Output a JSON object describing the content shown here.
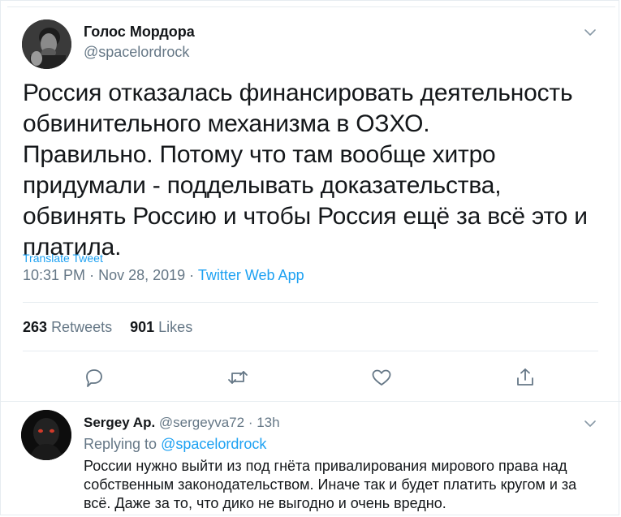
{
  "tweet": {
    "author_name": "Голос Мордора",
    "author_handle": "@spacelordrock",
    "text_lines": [
      "Россия отказалась финансировать деятельность обвинительного механизма в ОЗХО.",
      "Правильно. Потому что там вообще хитро придумали - подделывать доказательства, обвинять Россию и чтобы Россия ещё за всё это и платила."
    ],
    "translate_label": "Translate Tweet",
    "time": "10:31 PM",
    "dot1": "·",
    "date": "Nov 28, 2019",
    "dot2": "·",
    "source_app": "Twitter Web App",
    "retweets_count": "263",
    "retweets_label": "Retweets",
    "likes_count": "901",
    "likes_label": "Likes",
    "icons": {
      "reply": "reply-icon",
      "retweet": "retweet-icon",
      "like": "heart-icon",
      "share": "share-icon",
      "menu": "chevron-down-icon"
    }
  },
  "reply": {
    "author_name": "Sergey Ap.",
    "author_handle": "@sergeyva72",
    "dot": "·",
    "age": "13h",
    "replying_prefix": "Replying to",
    "replying_to": "@spacelordrock",
    "text": "России нужно выйти из под гнёта привалирования мирового права над собственным законодательством. Иначе так и будет платить кругом и за всё. Даже за то, что дико не выгодно и очень вредно."
  },
  "colors": {
    "accent": "#1da1f2",
    "secondary_text": "#657786",
    "primary_text": "#14171a",
    "divider": "#e6ecf0"
  }
}
